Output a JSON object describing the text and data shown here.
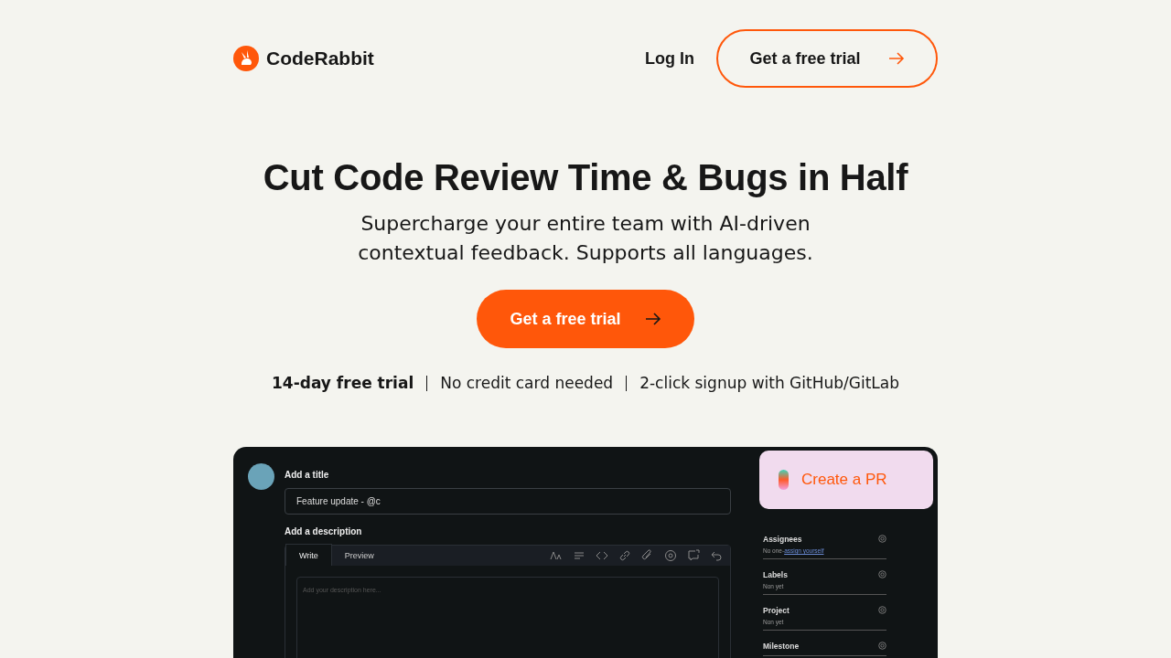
{
  "header": {
    "logo_text": "CodeRabbit",
    "login": "Log In",
    "cta": "Get a free trial"
  },
  "hero": {
    "title": "Cut Code Review Time & Bugs in Half",
    "subtitle": "Supercharge your entire team with AI-driven contextual feedback. Supports all languages.",
    "cta": "Get a free trial",
    "features": [
      {
        "text": "14-day free trial",
        "emphasized": true
      },
      {
        "text": "No credit card needed",
        "emphasized": false
      },
      {
        "text": "2-click signup with GitHub/GitLab",
        "emphasized": false
      }
    ]
  },
  "mockup": {
    "title_label": "Add a title",
    "title_value": "Feature update - @c",
    "description_label": "Add a description",
    "tabs": [
      {
        "label": "Write",
        "selected": true
      },
      {
        "label": "Preview",
        "selected": false
      }
    ],
    "placeholder": "Add your description here...",
    "create_pr": "Create a PR",
    "sidebar": [
      {
        "label": "Assignees",
        "value": "No one-",
        "link": "assign yourself"
      },
      {
        "label": "Labels",
        "value": "Non yet"
      },
      {
        "label": "Project",
        "value": "Non yet"
      },
      {
        "label": "Milestone"
      }
    ]
  }
}
